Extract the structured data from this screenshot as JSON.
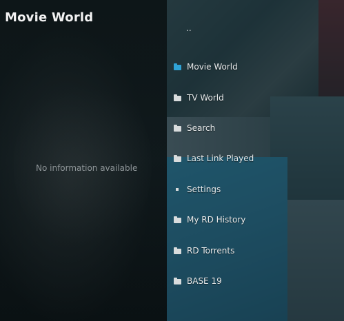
{
  "window": {
    "title": "Movie World"
  },
  "info_panel": {
    "message": "No information available"
  },
  "list": {
    "parent_item": "..",
    "items": [
      {
        "label": "Movie World",
        "icon": "folder-icon",
        "selected": true
      },
      {
        "label": "TV World",
        "icon": "folder-icon"
      },
      {
        "label": "Search",
        "icon": "folder-icon"
      },
      {
        "label": "Last Link Played",
        "icon": "folder-icon"
      },
      {
        "label": "Settings",
        "icon": "settings-square-icon"
      },
      {
        "label": "My RD History",
        "icon": "folder-icon"
      },
      {
        "label": "RD Torrents",
        "icon": "folder-icon"
      },
      {
        "label": "BASE 19",
        "icon": "folder-icon"
      }
    ]
  },
  "colors": {
    "accent": "#2fa3d6",
    "icon_default": "#d9dcdd"
  }
}
